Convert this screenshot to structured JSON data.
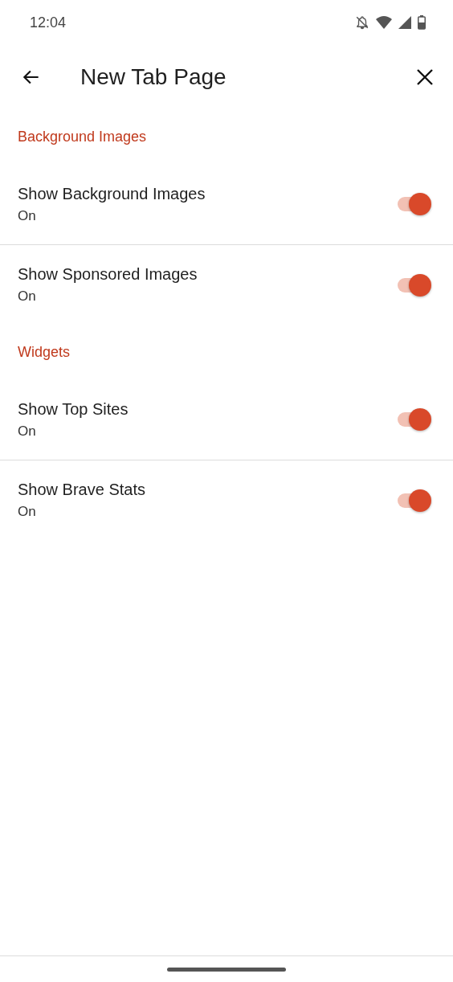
{
  "status_bar": {
    "time": "12:04"
  },
  "app_bar": {
    "title": "New Tab Page"
  },
  "sections": [
    {
      "header": "Background Images",
      "items": [
        {
          "title": "Show Background Images",
          "summary": "On",
          "on": true
        },
        {
          "title": "Show Sponsored Images",
          "summary": "On",
          "on": true
        }
      ]
    },
    {
      "header": "Widgets",
      "items": [
        {
          "title": "Show Top Sites",
          "summary": "On",
          "on": true
        },
        {
          "title": "Show Brave Stats",
          "summary": "On",
          "on": true
        }
      ]
    }
  ]
}
